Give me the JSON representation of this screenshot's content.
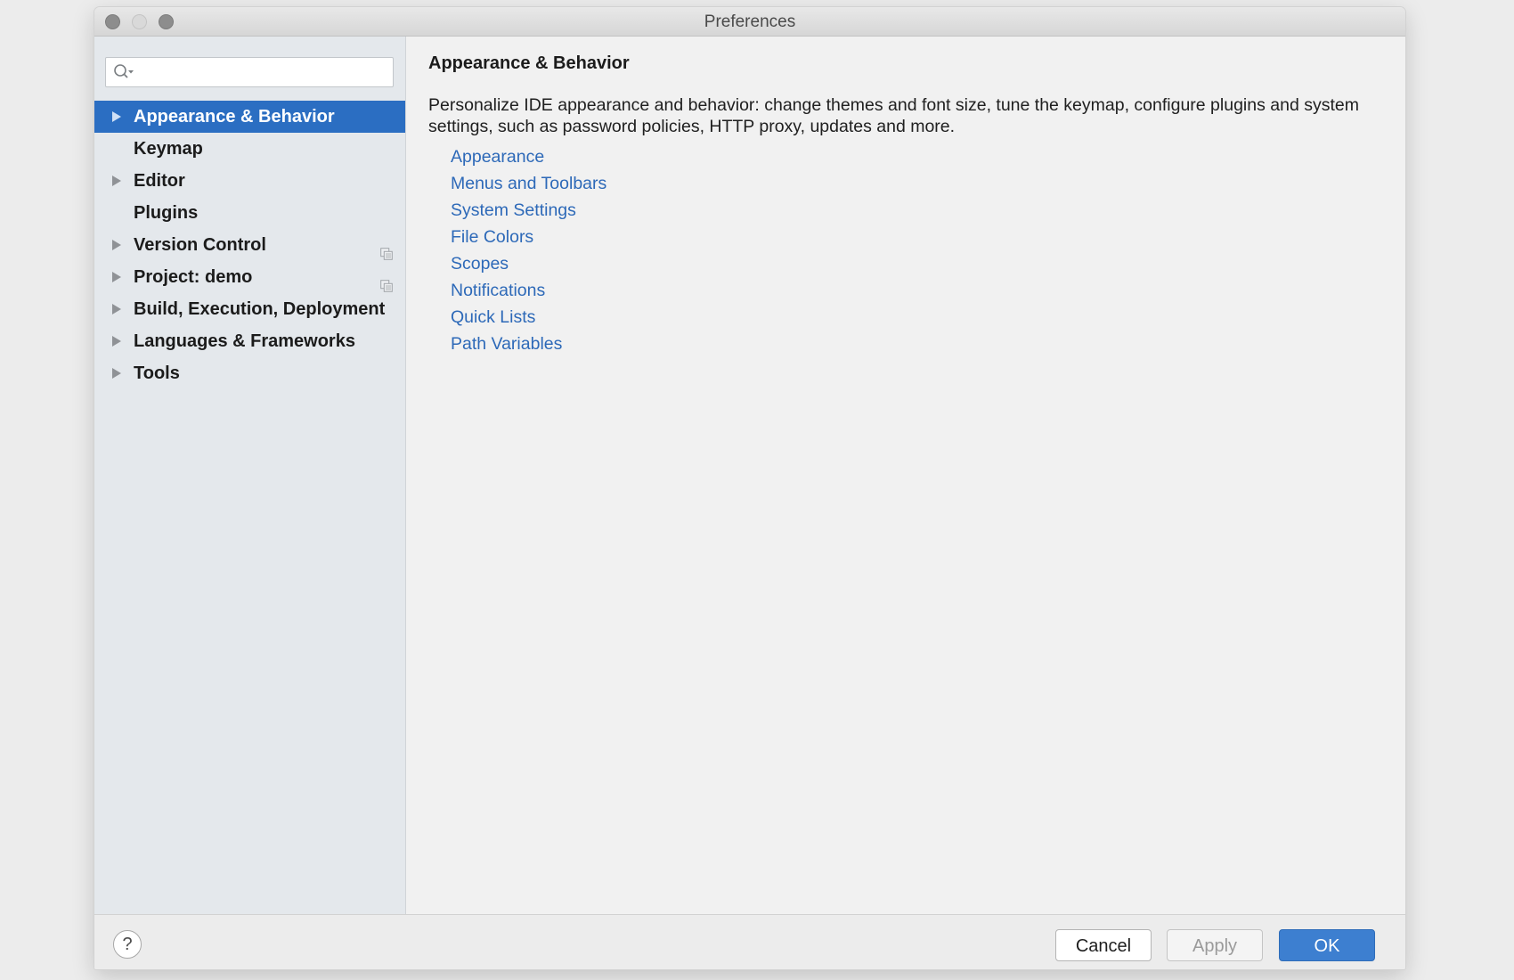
{
  "window": {
    "title": "Preferences"
  },
  "search": {
    "value": "",
    "placeholder": ""
  },
  "sidebar": {
    "items": [
      {
        "label": "Appearance & Behavior",
        "expandable": true,
        "selected": true,
        "project_level": false
      },
      {
        "label": "Keymap",
        "expandable": false,
        "selected": false,
        "project_level": false
      },
      {
        "label": "Editor",
        "expandable": true,
        "selected": false,
        "project_level": false
      },
      {
        "label": "Plugins",
        "expandable": false,
        "selected": false,
        "project_level": false
      },
      {
        "label": "Version Control",
        "expandable": true,
        "selected": false,
        "project_level": true
      },
      {
        "label": "Project: demo",
        "expandable": true,
        "selected": false,
        "project_level": true
      },
      {
        "label": "Build, Execution, Deployment",
        "expandable": true,
        "selected": false,
        "project_level": false
      },
      {
        "label": "Languages & Frameworks",
        "expandable": true,
        "selected": false,
        "project_level": false
      },
      {
        "label": "Tools",
        "expandable": true,
        "selected": false,
        "project_level": false
      }
    ]
  },
  "content": {
    "title": "Appearance & Behavior",
    "description": "Personalize IDE appearance and behavior: change themes and font size, tune the keymap, configure plugins and system settings, such as password policies, HTTP proxy, updates and more.",
    "links": [
      "Appearance",
      "Menus and Toolbars",
      "System Settings",
      "File Colors",
      "Scopes",
      "Notifications",
      "Quick Lists",
      "Path Variables"
    ]
  },
  "footer": {
    "help_label": "?",
    "cancel_label": "Cancel",
    "apply_label": "Apply",
    "ok_label": "OK",
    "apply_enabled": false
  },
  "colors": {
    "selection": "#2b6ec2",
    "link": "#2d69b8",
    "primary_button": "#3d7fd0",
    "sidebar_background": "#e4e8ec"
  },
  "icons": {
    "search": "search-icon",
    "expand": "chevron-right-icon",
    "project_level": "copy-icon",
    "help": "help-icon"
  }
}
